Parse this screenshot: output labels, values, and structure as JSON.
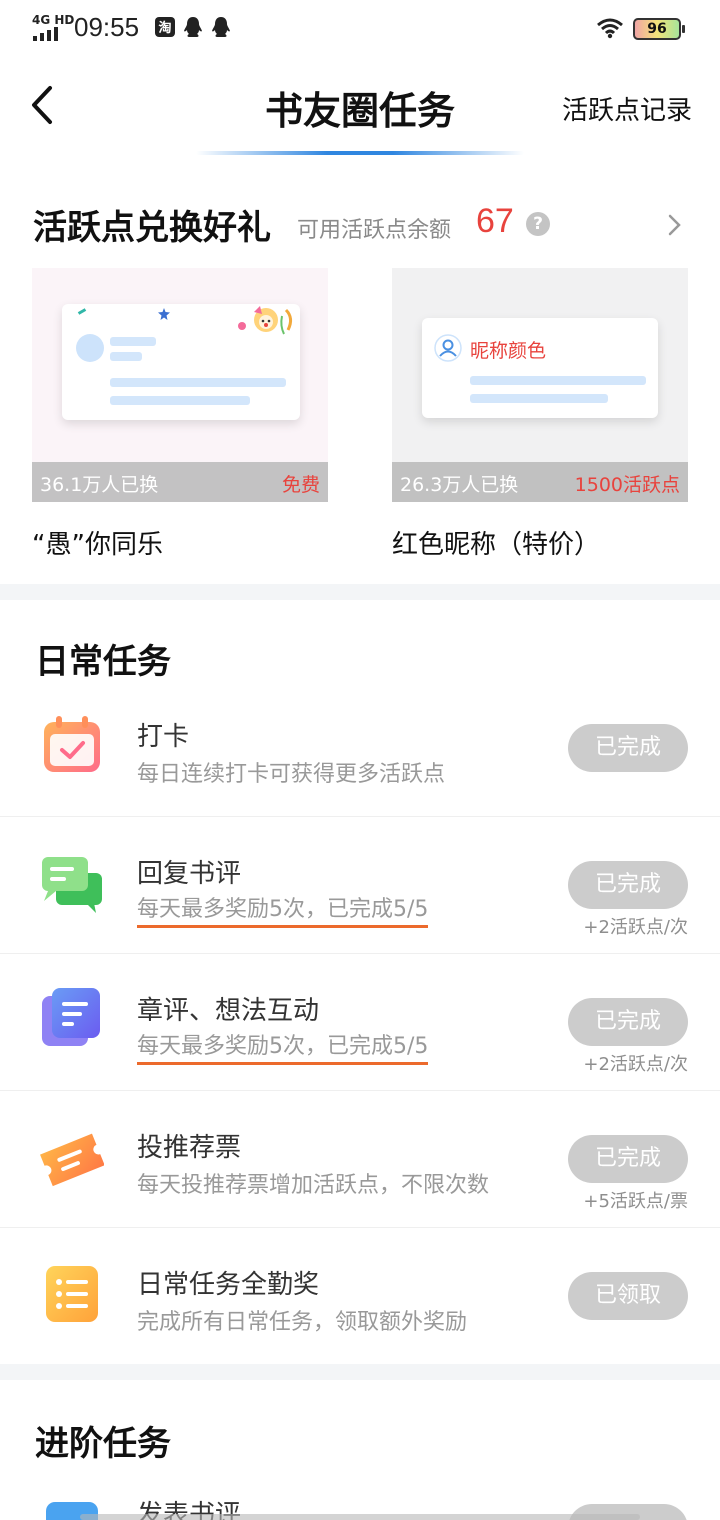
{
  "status_bar": {
    "network": "4G HD",
    "time": "09:55",
    "battery": "96",
    "icons": [
      "taobao-icon",
      "qq-icon",
      "qq-icon",
      "wifi-icon",
      "battery-icon"
    ]
  },
  "nav": {
    "title": "书友圈任务",
    "right_link": "活跃点记录",
    "accent_color": "#2f86e0"
  },
  "exchange": {
    "title": "活跃点兑换好礼",
    "balance_label": "可用活跃点余额",
    "balance": "67",
    "help": "?",
    "gifts": [
      {
        "count": "36.1万人已换",
        "price": "免费",
        "name": "“愚”你同乐"
      },
      {
        "count": "26.3万人已换",
        "price": "1500活跃点",
        "name": "红色昵称（特价）",
        "preview_text": "昵称颜色"
      }
    ]
  },
  "daily": {
    "title": "日常任务",
    "tasks": [
      {
        "icon": "calendar-check-icon",
        "title": "打卡",
        "desc": "每日连续打卡可获得更多活跃点",
        "button": "已完成",
        "reward": ""
      },
      {
        "icon": "chat-bubbles-icon",
        "title": "回复书评",
        "desc": "每天最多奖励5次，已完成5/5",
        "button": "已完成",
        "reward": "+2活跃点/次"
      },
      {
        "icon": "document-icon",
        "title": "章评、想法互动",
        "desc": "每天最多奖励5次，已完成5/5",
        "button": "已完成",
        "reward": "+2活跃点/次"
      },
      {
        "icon": "ticket-icon",
        "title": "投推荐票",
        "desc": "每天投推荐票增加活跃点，不限次数",
        "button": "已完成",
        "reward": "+5活跃点/票"
      },
      {
        "icon": "list-icon",
        "title": "日常任务全勤奖",
        "desc": "完成所有日常任务，领取额外奖励",
        "button": "已领取",
        "reward": ""
      }
    ]
  },
  "advanced": {
    "title": "进阶任务",
    "first_task_title": "发表书评"
  }
}
